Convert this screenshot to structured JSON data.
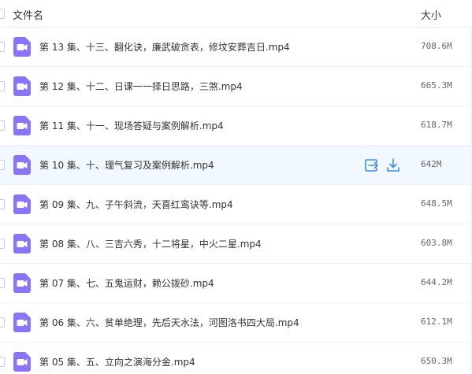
{
  "header": {
    "name_label": "文件名",
    "size_label": "大小"
  },
  "icons": {
    "file_type": "video-file-icon",
    "share": "share-icon",
    "download": "download-icon"
  },
  "colors": {
    "video_icon": "#8b74f5",
    "action_icon": "#3a8ee6",
    "hover_row": "#f2f8ff"
  },
  "files": [
    {
      "name": "第 13 集、十三、翻化诀，廉武破贪表，修坟安葬吉日.mp4",
      "size": "708.6M"
    },
    {
      "name": "第 12 集、十二、日课一一择日思路，三煞.mp4",
      "size": "665.3M"
    },
    {
      "name": "第 11 集、十一、现场答疑与案例解析.mp4",
      "size": "618.7M"
    },
    {
      "name": "第 10 集、十、理气复习及案例解析.mp4",
      "size": "642M"
    },
    {
      "name": "第 09 集、九、子午斜流，天喜红鸾诀等.mp4",
      "size": "648.5M"
    },
    {
      "name": "第 08 集、八、三吉六秀，十二将星，中火二星.mp4",
      "size": "603.8M"
    },
    {
      "name": "第 07 集、七、五鬼运财，赖公拨砂.mp4",
      "size": "644.2M"
    },
    {
      "name": "第 06 集、六、贫单绝理，先后天水法，河图洛书四大局.mp4",
      "size": "612.1M"
    },
    {
      "name": "第 05 集、五、立向之演海分金.mp4",
      "size": "650.3M"
    }
  ]
}
